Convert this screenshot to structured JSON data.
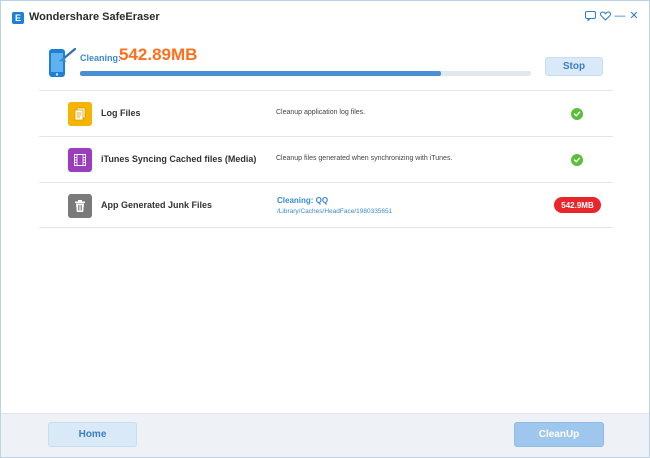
{
  "app": {
    "title": "Wondershare SafeEraser",
    "logo_letter": "E",
    "feedback_icon": "feedback-icon",
    "heart_icon": "heart-icon",
    "minimize_glyph": "—",
    "close_glyph": "✕"
  },
  "progress": {
    "label": "Cleaning:",
    "size": "542.89MB",
    "fraction": 0.8,
    "stop_label": "Stop"
  },
  "items": [
    {
      "name": "Log Files",
      "description": "Cleanup application log files.",
      "status": "done",
      "icon": "log-files-icon",
      "icon_color": "#f5b400"
    },
    {
      "name": "iTunes Syncing Cached files (Media)",
      "description": "Cleanup files generated when synchronizing with iTunes.",
      "status": "done",
      "icon": "film-icon",
      "icon_color": "#9b3dbf"
    },
    {
      "name": "App Generated Junk Files",
      "status_title": "Cleaning: QQ",
      "status_path": "/Library/Caches/HeadFace/1980335651",
      "badge": "542.9MB",
      "status": "cleaning",
      "icon": "trash-icon",
      "icon_color": "#7a7a7a"
    }
  ],
  "footer": {
    "home_label": "Home",
    "cleanup_label": "CleanUp"
  },
  "colors": {
    "accent": "#3a8ad0",
    "size_orange": "#ff6f1c",
    "check_green": "#5bbf3a",
    "badge_red": "#e8262b"
  }
}
